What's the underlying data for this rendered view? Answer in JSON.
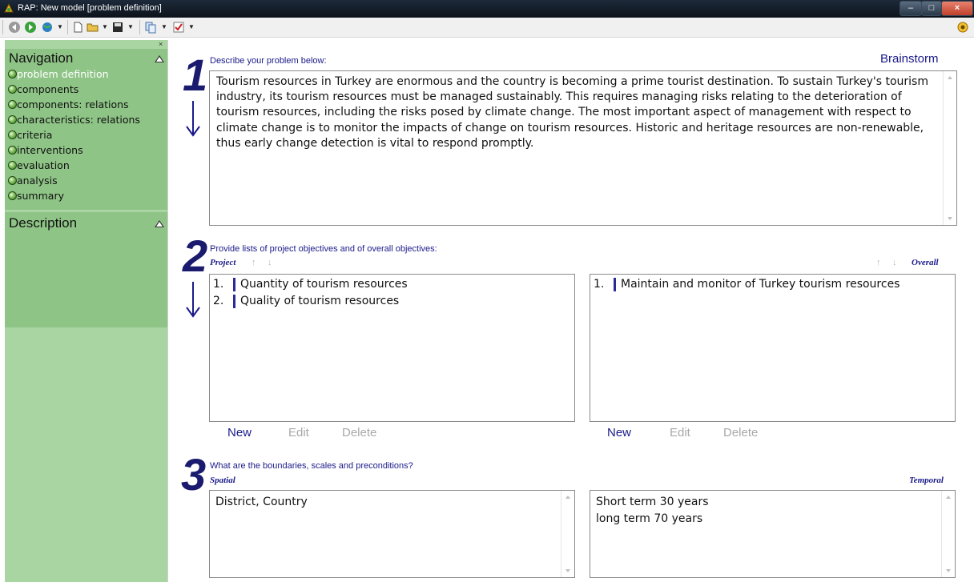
{
  "window": {
    "title": "RAP: New model [problem definition]"
  },
  "toolbar": {
    "icons": [
      "back-icon",
      "forward-icon",
      "globe-icon",
      "new-document-icon",
      "open-folder-icon",
      "save-icon",
      "copy-icon",
      "checklist-icon",
      "help-icon"
    ]
  },
  "sidebar": {
    "navigation_title": "Navigation",
    "description_title": "Description",
    "items": [
      {
        "label": "problem definition",
        "active": true
      },
      {
        "label": "components"
      },
      {
        "label": "components: relations"
      },
      {
        "label": "characteristics: relations"
      },
      {
        "label": "criteria"
      },
      {
        "label": "interventions"
      },
      {
        "label": "evaluation"
      },
      {
        "label": "analysis"
      },
      {
        "label": "summary"
      }
    ]
  },
  "main": {
    "brainstorm_label": "Brainstorm",
    "step1": {
      "number": "1",
      "instruction": "Describe your problem below:",
      "problem_text": "Tourism resources in Turkey are enormous and the country is becoming a prime tourist destination. To sustain Turkey's tourism industry, its tourism resources must be managed sustainably. This requires managing risks relating to the deterioration of tourism resources, including the risks posed by climate change. The most important aspect of management with respect to climate change is to monitor the impacts of change on tourism resources. Historic and heritage resources are non-renewable, thus early change detection is vital to respond promptly."
    },
    "step2": {
      "number": "2",
      "instruction": "Provide lists of project objectives and of overall objectives:",
      "project_label": "Project",
      "overall_label": "Overall",
      "project_items": [
        {
          "num": "1.",
          "text": "Quantity of tourism resources"
        },
        {
          "num": "2.",
          "text": "Quality of tourism resources"
        }
      ],
      "overall_items": [
        {
          "num": "1.",
          "text": "Maintain and monitor of Turkey tourism resources"
        }
      ],
      "buttons": {
        "new": "New",
        "edit": "Edit",
        "delete": "Delete"
      }
    },
    "step3": {
      "number": "3",
      "instruction": "What are the boundaries, scales and preconditions?",
      "spatial_label": "Spatial",
      "temporal_label": "Temporal",
      "spatial_text": "District, Country",
      "temporal_text": "Short term 30 years\nlong term 70 years"
    }
  }
}
